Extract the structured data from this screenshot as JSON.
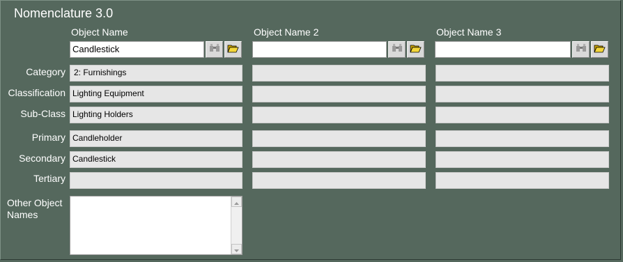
{
  "title": "Nomenclature 3.0",
  "columns": [
    {
      "header": "Object Name",
      "value": ""
    },
    {
      "header": "Object Name 2",
      "value": ""
    },
    {
      "header": "Object Name 3",
      "value": ""
    }
  ],
  "object_name_value": "Candlestick",
  "rows": [
    {
      "label": "Category",
      "values": [
        "2: Furnishings",
        "",
        ""
      ]
    },
    {
      "label": "Classification",
      "values": [
        "Lighting Equipment",
        "",
        ""
      ]
    },
    {
      "label": "Sub-Class",
      "values": [
        "Lighting Holders",
        "",
        ""
      ]
    },
    {
      "label": "Primary",
      "values": [
        "Candleholder",
        "",
        ""
      ]
    },
    {
      "label": "Secondary",
      "values": [
        "Candlestick",
        "",
        ""
      ]
    },
    {
      "label": "Tertiary",
      "values": [
        "",
        "",
        ""
      ]
    }
  ],
  "other_names_label": "Other Object Names",
  "other_names_value": "",
  "icons": {
    "find": "binoculars-icon",
    "browse": "open-folder-icon"
  },
  "colors": {
    "background": "#55685d",
    "field": "#e6e6e6",
    "input": "#ffffff"
  }
}
